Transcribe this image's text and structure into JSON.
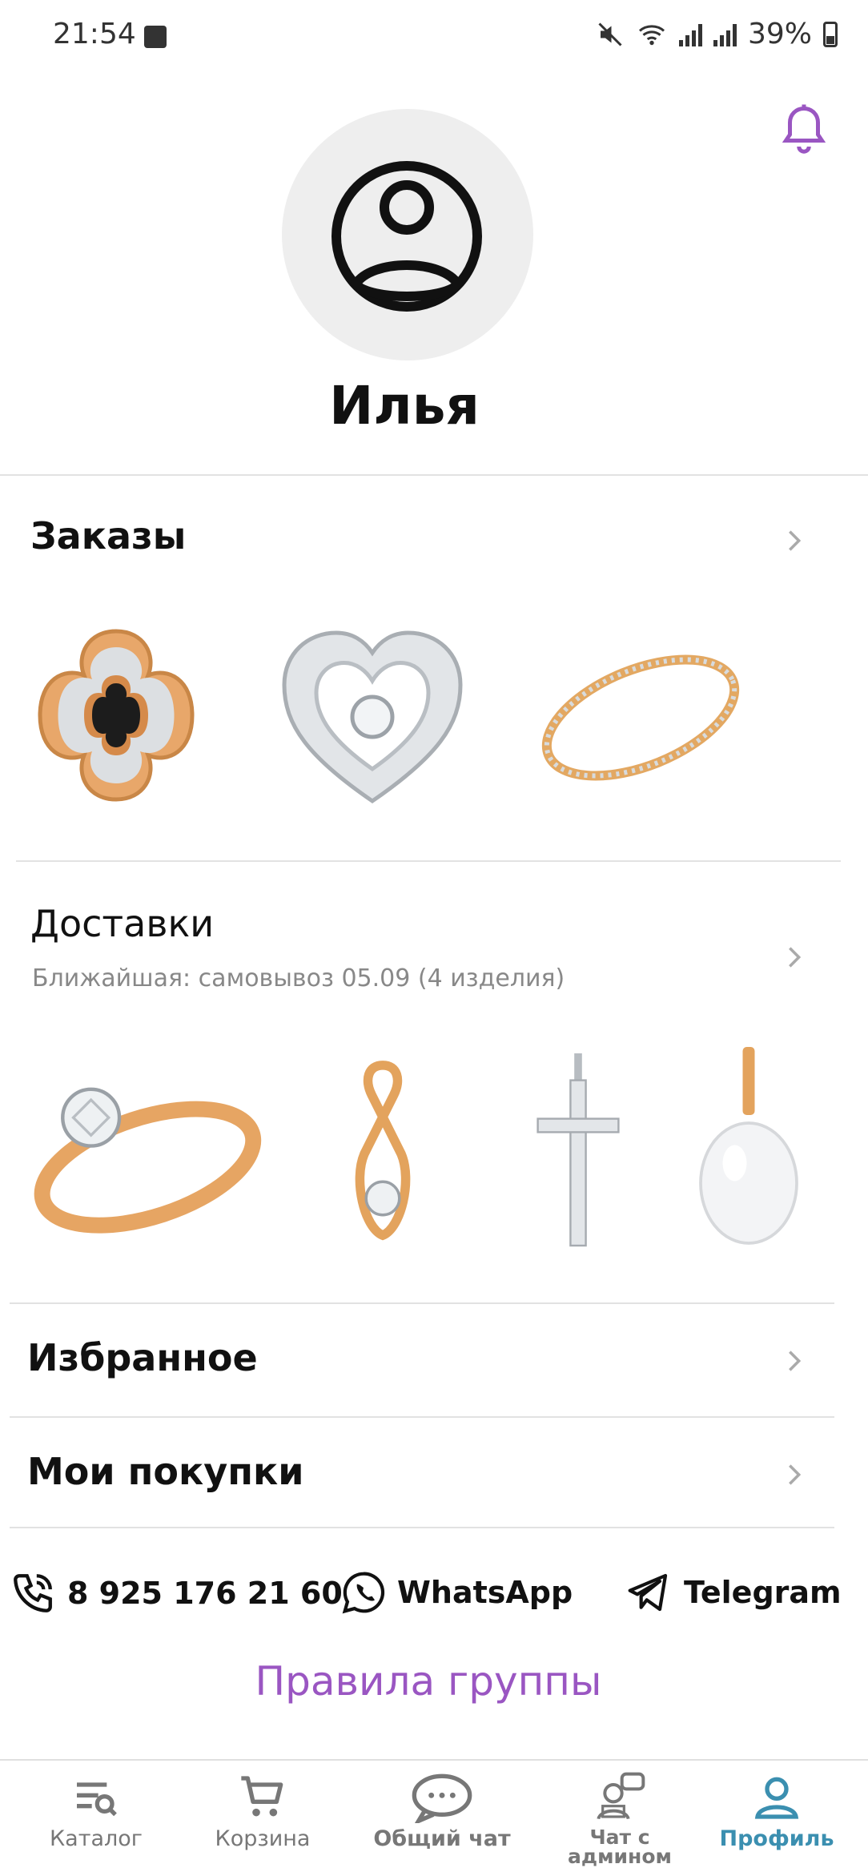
{
  "status_bar": {
    "time": "21:54",
    "battery": "39%"
  },
  "profile": {
    "name": "Илья"
  },
  "orders": {
    "title": "Заказы"
  },
  "deliveries": {
    "title": "Доставки",
    "subtitle": "Ближайшая: самовывоз  05.09  (4 изделия)"
  },
  "favorites": {
    "title": "Избранное"
  },
  "purchases": {
    "title": "Мои покупки"
  },
  "contacts": {
    "phone": "8 925 176 21 60",
    "whatsapp": "WhatsApp",
    "telegram": "Telegram"
  },
  "rules_link": "Правила группы",
  "tabs": [
    {
      "label": "Каталог",
      "icon": "catalog-icon"
    },
    {
      "label": "Корзина",
      "icon": "cart-icon"
    },
    {
      "label": "Общий чат",
      "icon": "chat-icon"
    },
    {
      "label": "Чат с админом",
      "icon": "admin-chat-icon"
    },
    {
      "label": "Профиль",
      "icon": "profile-icon",
      "active": true
    }
  ],
  "colors": {
    "accent_purple": "#9a56c2",
    "active_tab": "#3b8fb0",
    "gold": "#e0a35a",
    "silver": "#cfd3d6"
  }
}
